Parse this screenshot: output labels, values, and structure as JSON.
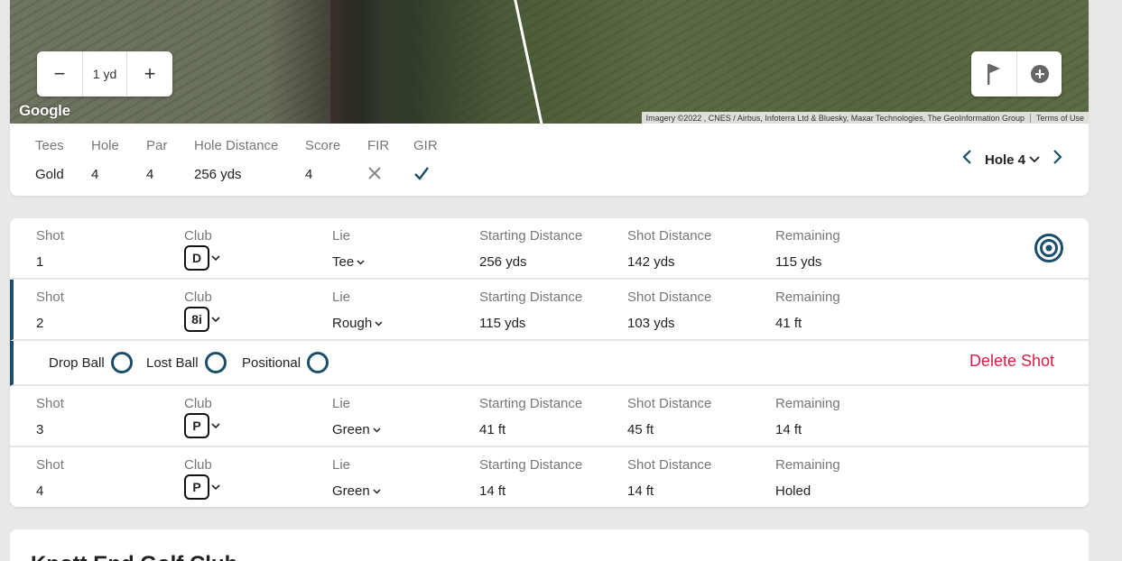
{
  "map": {
    "zoom": {
      "minus": "−",
      "value": "1 yd",
      "plus": "+"
    },
    "google_logo": "Google",
    "attribution": "Imagery ©2022 , CNES / Airbus, Infoterra Ltd & Bluesky, Maxar Technologies, The GeoInformation Group",
    "terms": "Terms of Use",
    "tools": [
      "flag-icon",
      "add-circle-icon"
    ]
  },
  "summary": {
    "tees": {
      "label": "Tees",
      "value": "Gold"
    },
    "hole": {
      "label": "Hole",
      "value": "4"
    },
    "par": {
      "label": "Par",
      "value": "4"
    },
    "distance": {
      "label": "Hole Distance",
      "value": "256 yds"
    },
    "score": {
      "label": "Score",
      "value": "4"
    },
    "fir": {
      "label": "FIR",
      "icon": "cross-icon"
    },
    "gir": {
      "label": "GIR",
      "icon": "check-icon"
    },
    "hole_select": "Hole 4"
  },
  "labels": {
    "shot": "Shot",
    "club": "Club",
    "lie": "Lie",
    "start": "Starting Distance",
    "shotdist": "Shot Distance",
    "remaining": "Remaining"
  },
  "shots": [
    {
      "shot": "1",
      "club": "D",
      "lie": "Tee",
      "start": "256 yds",
      "distance": "142 yds",
      "remaining": "115 yds"
    },
    {
      "shot": "2",
      "club": "8i",
      "lie": "Rough",
      "start": "115 yds",
      "distance": "103 yds",
      "remaining": "41 ft"
    },
    {
      "shot": "3",
      "club": "P",
      "lie": "Green",
      "start": "41 ft",
      "distance": "45 ft",
      "remaining": "14 ft"
    },
    {
      "shot": "4",
      "club": "P",
      "lie": "Green",
      "start": "14 ft",
      "distance": "14 ft",
      "remaining": "Holed"
    }
  ],
  "options": {
    "drop_ball": "Drop Ball",
    "lost_ball": "Lost Ball",
    "positional": "Positional",
    "delete": "Delete Shot"
  },
  "course": {
    "title": "Knott End Golf Club"
  },
  "colors": {
    "accent": "#1b4e6b",
    "danger": "#dc1b45"
  }
}
